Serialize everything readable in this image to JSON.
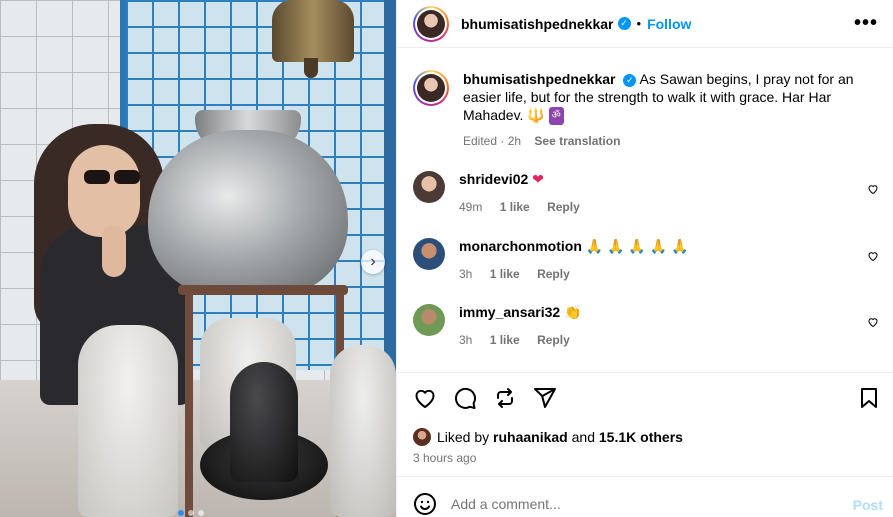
{
  "post": {
    "username": "bhumisatishpednekkar",
    "verified_mark": "✓",
    "follow_label": "Follow",
    "more_label": "•••",
    "separator": "•"
  },
  "caption": {
    "username": "bhumisatishpednekkar",
    "text": "As Sawan begins, I pray not for an easier life, but for the strength to walk it with grace. Har Har Mahadev.",
    "emoji_trident": "🔱",
    "emoji_om": "ॐ",
    "edited": "Edited · 2h",
    "see_translation": "See translation"
  },
  "comments": [
    {
      "username": "shridevi02",
      "text": "❤",
      "time": "49m",
      "likes": "1 like",
      "reply": "Reply",
      "avatar_color": "#6d7a8a"
    },
    {
      "username": "monarchonmotion",
      "text": "🙏 🙏 🙏 🙏 🙏",
      "time": "3h",
      "likes": "1 like",
      "reply": "Reply",
      "avatar_color": "#c06a3a"
    },
    {
      "username": "immy_ansari32",
      "text": "👏",
      "time": "3h",
      "likes": "1 like",
      "reply": "Reply",
      "avatar_color": "#7aa85a"
    }
  ],
  "likes": {
    "prefix": "Liked by",
    "user": "ruhaanikad",
    "and": "and",
    "others": "15.1K others"
  },
  "timestamp": "3 hours ago",
  "comment_box": {
    "placeholder": "Add a comment...",
    "post_label": "Post"
  },
  "carousel": {
    "next_label": "›",
    "slide_count": 3,
    "active_slide": 1
  },
  "colors": {
    "link_blue": "#0095f6",
    "post_disabled": "#b2dffc",
    "muted": "#737373"
  },
  "icons": [
    "heart-icon",
    "comment-icon",
    "repost-icon",
    "share-icon",
    "bookmark-icon",
    "emoji-icon",
    "verified-icon"
  ]
}
